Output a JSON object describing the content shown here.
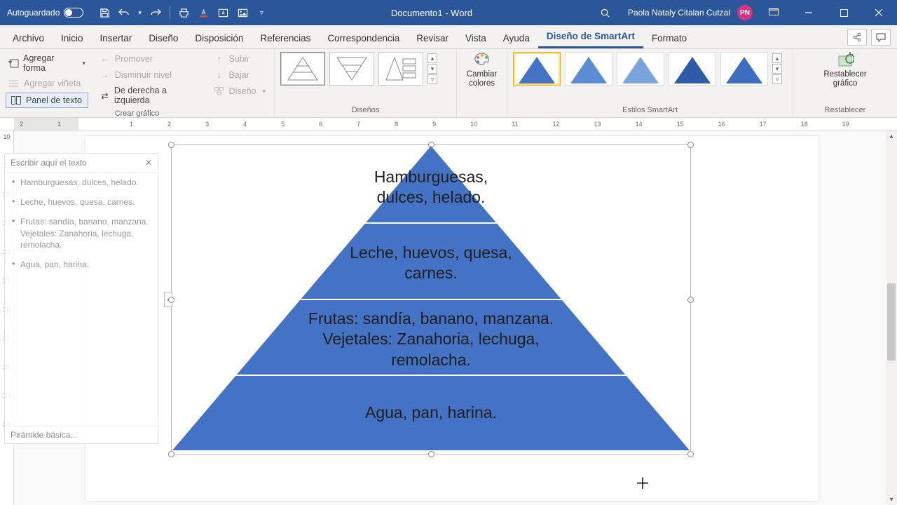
{
  "titlebar": {
    "autosave": "Autoguardado",
    "doc_title": "Documento1 - Word",
    "user_name": "Paola Nataly Citalan Cutzal",
    "user_initials": "PN"
  },
  "tabs": {
    "items": [
      "Archivo",
      "Inicio",
      "Insertar",
      "Diseño",
      "Disposición",
      "Referencias",
      "Correspondencia",
      "Revisar",
      "Vista",
      "Ayuda",
      "Diseño de SmartArt",
      "Formato"
    ],
    "active": 10
  },
  "ribbon": {
    "crear": {
      "agregar_forma": "Agregar forma",
      "agregar_vineta": "Agregar viñeta",
      "panel_texto": "Panel de texto",
      "promover": "Promover",
      "disminuir": "Disminuir nivel",
      "derecha_izq": "De derecha a izquierda",
      "subir": "Subir",
      "bajar": "Bajar",
      "diseno": "Diseño",
      "label": "Crear gráfico"
    },
    "disenos": {
      "label": "Diseños"
    },
    "colores": {
      "label": "Cambiar colores"
    },
    "estilos": {
      "label": "Estilos SmartArt"
    },
    "restablecer": {
      "btn": "Restablecer gráfico",
      "label": "Restablecer"
    }
  },
  "textpane": {
    "title": "Escribir aquí el texto",
    "items": [
      "Hamburguesas, dulces, helado.",
      "Leche, huevos, quesa, carnes.",
      "Frutas: sandía, banano, manzana.  Vejetales: Zanahoria, lechuga, remolacha.",
      "Agua, pan, harina."
    ],
    "footer": "Pirámide básica..."
  },
  "chart_data": {
    "type": "pyramid",
    "levels": [
      "Hamburguesas, dulces, helado.",
      "Leche, huevos, quesa, carnes.",
      "Frutas: sandía, banano, manzana.  Vejetales: Zanahoria, lechuga, remolacha.",
      "Agua, pan, harina."
    ],
    "color": "#4472c4"
  },
  "ruler": {
    "h": [
      "2",
      "1",
      "",
      "1",
      "2",
      "3",
      "4",
      "5",
      "6",
      "7",
      "8",
      "9",
      "10",
      "11",
      "12",
      "13",
      "14",
      "15",
      "16",
      "17",
      "18",
      "19"
    ],
    "v": [
      "10",
      "11",
      "12",
      "13",
      "14",
      "15",
      "16",
      "17",
      "18",
      "19",
      "20"
    ]
  }
}
